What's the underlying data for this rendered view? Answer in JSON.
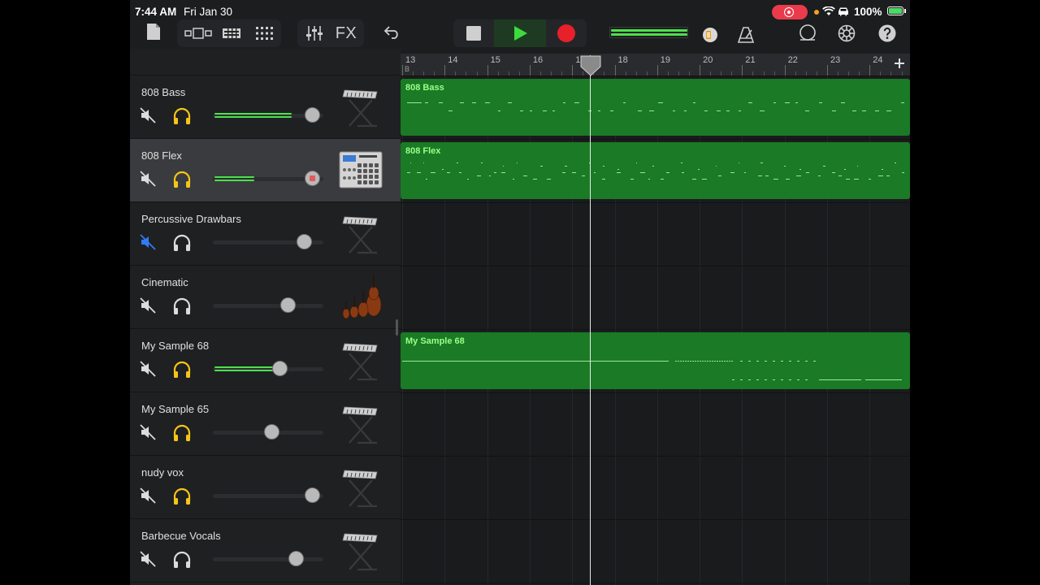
{
  "status_bar": {
    "time": "7:44 AM",
    "date": "Fri Jan 30",
    "battery": "100%"
  },
  "toolbar": {
    "fx_label": "FX"
  },
  "ruler": {
    "bars": [
      "13",
      "14",
      "15",
      "16",
      "17",
      "18",
      "19",
      "20",
      "21",
      "22",
      "23",
      "24"
    ],
    "section": "B"
  },
  "tracks": [
    {
      "name": "808 Bass",
      "muted": false,
      "soloed": true,
      "volume": 0.9,
      "level": 0.7,
      "instrument": "keyboard-icon",
      "selected": false
    },
    {
      "name": "808 Flex",
      "muted": false,
      "soloed": true,
      "volume": 0.9,
      "level": 0.36,
      "instrument": "drum-machine-icon",
      "selected": true
    },
    {
      "name": "Percussive Drawbars",
      "muted": true,
      "soloed": false,
      "volume": 0.82,
      "level": 0,
      "instrument": "keyboard-icon",
      "selected": false
    },
    {
      "name": "Cinematic",
      "muted": false,
      "soloed": false,
      "volume": 0.68,
      "level": 0,
      "instrument": "strings-icon",
      "selected": false
    },
    {
      "name": "My Sample 68",
      "muted": false,
      "soloed": true,
      "volume": 0.6,
      "level": 0.56,
      "instrument": "keyboard-icon",
      "selected": false
    },
    {
      "name": "My Sample 65",
      "muted": false,
      "soloed": true,
      "volume": 0.53,
      "level": 0,
      "instrument": "keyboard-icon",
      "selected": false
    },
    {
      "name": "nudy vox",
      "muted": false,
      "soloed": true,
      "volume": 0.9,
      "level": 0,
      "instrument": "keyboard-icon",
      "selected": false
    },
    {
      "name": "Barbecue Vocals",
      "muted": false,
      "soloed": false,
      "volume": 0.75,
      "level": 0,
      "instrument": "keyboard-icon",
      "selected": false
    }
  ],
  "regions": [
    {
      "track": 0,
      "label": "808 Bass"
    },
    {
      "track": 1,
      "label": "808 Flex"
    },
    {
      "track": 4,
      "label": "My Sample 68"
    }
  ],
  "colors": {
    "accent_green": "#4ee04e",
    "region_green": "#1a7a25",
    "solo_yellow": "#f5c518",
    "mute_blue": "#2f7cf6",
    "record_red": "#e8202a"
  }
}
